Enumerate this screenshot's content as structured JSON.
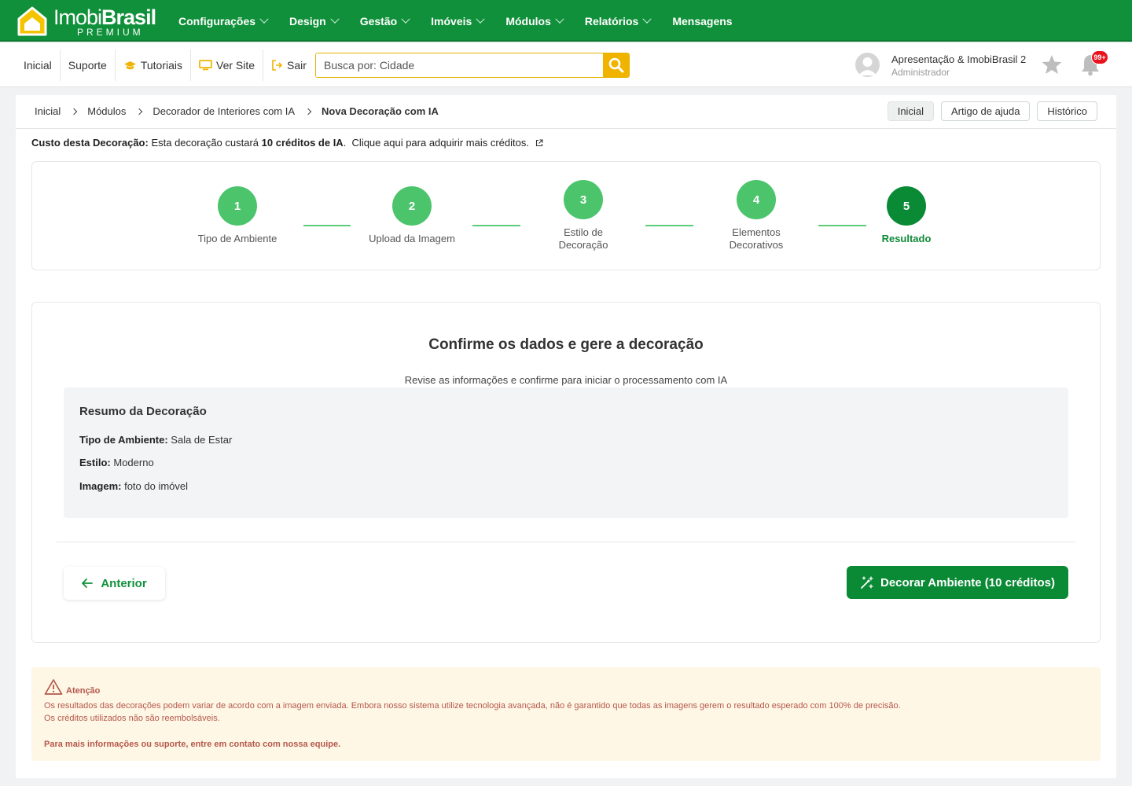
{
  "brand": {
    "name_light": "Imobi",
    "name_bold": "Brasil",
    "tagline": "PREMIUM"
  },
  "main_nav": [
    {
      "label": "Configurações",
      "has_dropdown": true
    },
    {
      "label": "Design",
      "has_dropdown": true
    },
    {
      "label": "Gestão",
      "has_dropdown": true
    },
    {
      "label": "Imóveis",
      "has_dropdown": true
    },
    {
      "label": "Módulos",
      "has_dropdown": true
    },
    {
      "label": "Relatórios",
      "has_dropdown": true
    },
    {
      "label": "Mensagens",
      "has_dropdown": false
    }
  ],
  "sub_nav": [
    {
      "label": "Inicial",
      "icon": ""
    },
    {
      "label": "Suporte",
      "icon": ""
    },
    {
      "label": "Tutoriais",
      "icon": "graduation-cap-icon"
    },
    {
      "label": "Ver Site",
      "icon": "monitor-icon"
    },
    {
      "label": "Sair",
      "icon": "logout-icon"
    }
  ],
  "search": {
    "placeholder": "Busca por: Cidade",
    "value": ""
  },
  "user": {
    "name": "Apresentação & ImobiBrasil 2",
    "role": "Administrador",
    "notifications": "99+"
  },
  "breadcrumb": [
    "Inicial",
    "Módulos",
    "Decorador de Interiores com IA",
    "Nova Decoração com IA"
  ],
  "top_buttons": [
    "Inicial",
    "Artigo de ajuda",
    "Histórico"
  ],
  "cost": {
    "label": "Custo desta Decoração:",
    "text_before": "Esta decoração custará",
    "credits": "10 créditos de IA",
    "text_after": ".  Clique aqui para adquirir mais créditos."
  },
  "steps": [
    {
      "number": "1",
      "label": "Tipo de Ambiente",
      "active": false
    },
    {
      "number": "2",
      "label": "Upload da Imagem",
      "active": false
    },
    {
      "number": "3",
      "label": "Estilo de Decoração",
      "active": false
    },
    {
      "number": "4",
      "label": "Elementos Decorativos",
      "active": false
    },
    {
      "number": "5",
      "label": "Resultado",
      "active": true
    }
  ],
  "confirm": {
    "title": "Confirme os dados e gere a decoração",
    "subtitle": "Revise as informações e confirme para iniciar o processamento com IA"
  },
  "summary": {
    "title": "Resumo da Decoração",
    "rows": [
      {
        "label": "Tipo de Ambiente:",
        "value": "Sala de Estar"
      },
      {
        "label": "Estilo:",
        "value": "Moderno"
      },
      {
        "label": "Imagem:",
        "value": "foto do imóvel"
      }
    ]
  },
  "actions": {
    "previous": "Anterior",
    "submit": "Decorar Ambiente (10 créditos)"
  },
  "alert": {
    "title": "Atenção",
    "line1": "Os resultados das decorações podem variar de acordo com a imagem enviada. Embora nosso sistema utilize tecnologia avançada, não é garantido que todas as imagens gerem o resultado esperado com 100% de precisão.",
    "line2": "Os créditos utilizados não são reembolsáveis.",
    "line3": "Para mais informações ou suporte, entre em contato com nossa equipe."
  },
  "colors": {
    "brand_green": "#10903a",
    "step_green": "#4cc46b",
    "active_green": "#0a8a35",
    "search_yellow": "#f0b400",
    "alert_bg": "#fff7e6",
    "alert_text": "#b4584b",
    "badge_red": "#e8131c"
  }
}
